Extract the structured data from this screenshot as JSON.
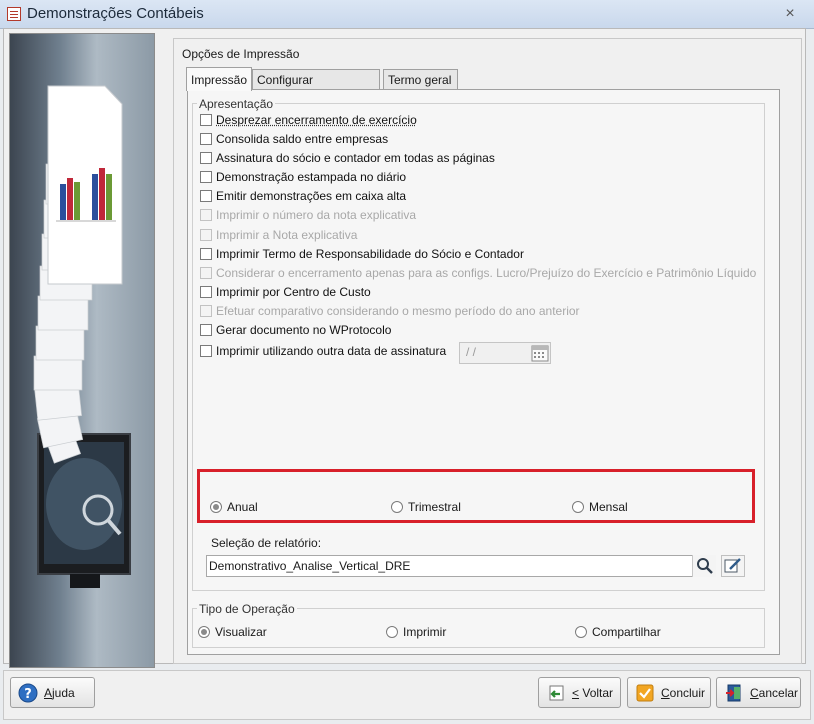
{
  "window": {
    "title": "Demonstrações Contábeis",
    "close_symbol": "×"
  },
  "panel": {
    "title": "Opções de Impressão",
    "tabs": [
      {
        "label": "Impressão",
        "active": true
      },
      {
        "label": "Configurar Assinaturas",
        "active": false
      },
      {
        "label": "Termo geral",
        "active": false
      }
    ]
  },
  "apresentacao": {
    "title": "Apresentação",
    "options": [
      {
        "label": "Desprezar encerramento de exercício",
        "checked": false,
        "enabled": true
      },
      {
        "label": "Consolida saldo entre empresas",
        "checked": false,
        "enabled": true
      },
      {
        "label": "Assinatura do sócio e contador em todas as páginas",
        "checked": false,
        "enabled": true
      },
      {
        "label": "Demonstração estampada no diário",
        "checked": false,
        "enabled": true
      },
      {
        "label": "Emitir demonstrações em caixa alta",
        "checked": false,
        "enabled": true
      },
      {
        "label": "Imprimir o número da nota explicativa",
        "checked": false,
        "enabled": false
      },
      {
        "label": "Imprimir a Nota explicativa",
        "checked": false,
        "enabled": false
      },
      {
        "label": "Imprimir Termo de Responsabilidade do Sócio e Contador",
        "checked": false,
        "enabled": true
      },
      {
        "label": "Considerar o encerramento apenas para as configs. Lucro/Prejuízo do Exercício e Patrimônio Líquido",
        "checked": false,
        "enabled": false
      },
      {
        "label": "Imprimir por Centro de Custo",
        "checked": false,
        "enabled": true
      },
      {
        "label": "Efetuar comparativo considerando o mesmo período do ano anterior",
        "checked": false,
        "enabled": false
      },
      {
        "label": "Gerar documento no WProtocolo",
        "checked": false,
        "enabled": true
      },
      {
        "label": "Imprimir utilizando outra data de assinatura",
        "checked": false,
        "enabled": true
      }
    ],
    "date_placeholder": "/ /"
  },
  "periodicidade": {
    "options": [
      {
        "label": "Anual",
        "selected": true
      },
      {
        "label": "Trimestral",
        "selected": false
      },
      {
        "label": "Mensal",
        "selected": false
      }
    ]
  },
  "relatorio": {
    "label": "Seleção de relatório:",
    "value": "Demonstrativo_Analise_Vertical_DRE"
  },
  "tipo_operacao": {
    "title": "Tipo de Operação",
    "options": [
      {
        "label": "Visualizar",
        "selected": true
      },
      {
        "label": "Imprimir",
        "selected": false
      },
      {
        "label": "Compartilhar",
        "selected": false
      }
    ]
  },
  "buttons": {
    "help": "Ajuda",
    "back": "< Voltar",
    "finish": "Concluir",
    "cancel": "Cancelar"
  },
  "colors": {
    "highlight": "#d8202a",
    "titlebar": "#dbe6f4"
  }
}
